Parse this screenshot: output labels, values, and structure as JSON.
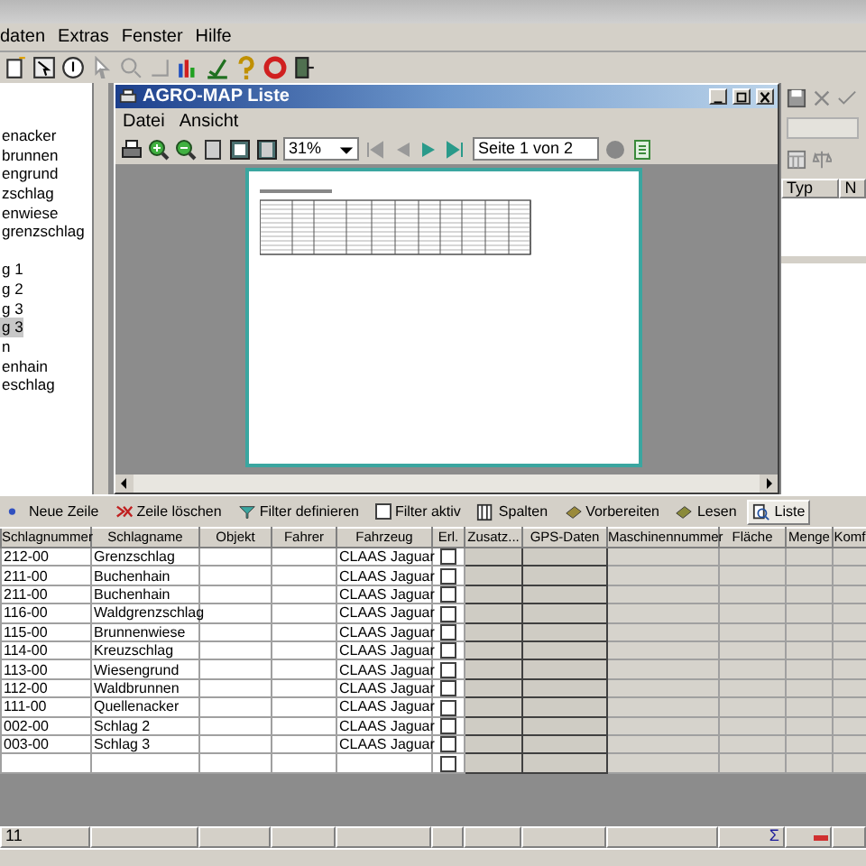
{
  "menu": [
    "daten",
    "Extras",
    "Fenster",
    "Hilfe"
  ],
  "tree": {
    "groups": [
      [
        {
          "label": "enacker",
          "selected": false
        },
        {
          "label": "brunnen",
          "selected": false
        },
        {
          "label": "engrund",
          "selected": false
        },
        {
          "label": "zschlag",
          "selected": false
        },
        {
          "label": "enwiese",
          "selected": false
        },
        {
          "label": "grenzschlag",
          "selected": false
        }
      ],
      [
        {
          "label": "g 1",
          "selected": false
        },
        {
          "label": "g 2",
          "selected": false
        },
        {
          "label": "g 3",
          "selected": false
        },
        {
          "label": "g 3",
          "selected": true
        },
        {
          "label": "n",
          "selected": false
        },
        {
          "label": "enhain",
          "selected": false
        },
        {
          "label": "eschlag",
          "selected": false
        }
      ]
    ]
  },
  "child_window": {
    "title": "AGRO-MAP Liste",
    "menu": [
      "Datei",
      "Ansicht"
    ],
    "zoom": "31%",
    "page_field": "Seite 1 von 2"
  },
  "side_panel": {
    "columns": [
      "Typ",
      "N"
    ]
  },
  "grid_toolbar": [
    {
      "kind": "button",
      "label": "Neue Zeile"
    },
    {
      "kind": "button",
      "label": "Zeile löschen"
    },
    {
      "kind": "button",
      "label": "Filter definieren"
    },
    {
      "kind": "checkbox",
      "label": "Filter aktiv",
      "checked": false
    },
    {
      "kind": "button",
      "label": "Spalten"
    },
    {
      "kind": "button",
      "label": "Vorbereiten"
    },
    {
      "kind": "button",
      "label": "Lesen"
    },
    {
      "kind": "toggle",
      "label": "Liste",
      "selected": true
    }
  ],
  "table": {
    "columns": [
      "Schlagnummer",
      "Schlagname",
      "Objekt",
      "Fahrer",
      "Fahrzeug",
      "Erl.",
      "Zusatz...",
      "GPS-Daten",
      "Maschinennummer",
      "Fläche",
      "Menge",
      "Komf"
    ],
    "rows": [
      {
        "number": "212-00",
        "name": "Grenzschlag",
        "vehicle": "CLAAS Jaguar",
        "done": false
      },
      {
        "number": "211-00",
        "name": "Buchenhain",
        "vehicle": "CLAAS Jaguar",
        "done": false
      },
      {
        "number": "211-00",
        "name": "Buchenhain",
        "vehicle": "CLAAS Jaguar",
        "done": false
      },
      {
        "number": "116-00",
        "name": "Waldgrenzschlag",
        "vehicle": "CLAAS Jaguar",
        "done": false
      },
      {
        "number": "115-00",
        "name": "Brunnenwiese",
        "vehicle": "CLAAS Jaguar",
        "done": false
      },
      {
        "number": "114-00",
        "name": "Kreuzschlag",
        "vehicle": "CLAAS Jaguar",
        "done": false
      },
      {
        "number": "113-00",
        "name": "Wiesengrund",
        "vehicle": "CLAAS Jaguar",
        "done": false
      },
      {
        "number": "112-00",
        "name": "Waldbrunnen",
        "vehicle": "CLAAS Jaguar",
        "done": false
      },
      {
        "number": "111-00",
        "name": "Quellenacker",
        "vehicle": "CLAAS Jaguar",
        "done": false
      },
      {
        "number": "002-00",
        "name": "Schlag 2",
        "vehicle": "CLAAS Jaguar",
        "done": false
      },
      {
        "number": "003-00",
        "name": "Schlag 3",
        "vehicle": "CLAAS Jaguar",
        "done": false
      }
    ],
    "new_row": {
      "done": false
    }
  },
  "footer": {
    "count": "11",
    "sum_symbol": "Σ"
  }
}
